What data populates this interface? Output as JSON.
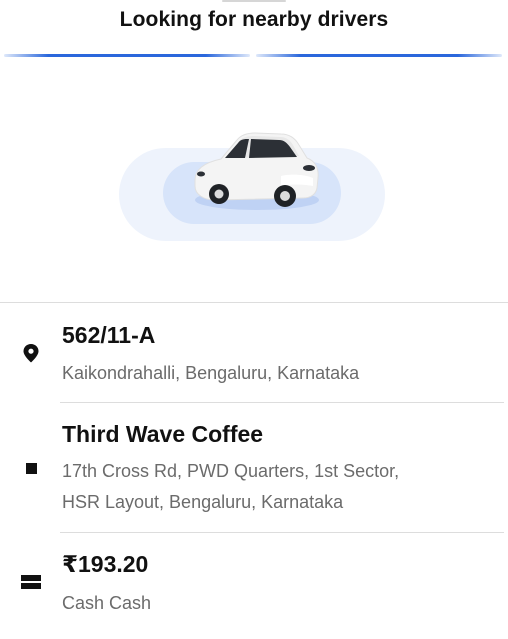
{
  "header": {
    "title": "Looking for nearby drivers"
  },
  "pickup": {
    "icon": "location-pin-icon",
    "name": "562/11-A",
    "address": "Kaikondrahalli, Bengaluru, Karnataka"
  },
  "dropoff": {
    "icon": "square-stop-icon",
    "name": "Third Wave Coffee",
    "address_line1": "17th Cross Rd, PWD Quarters, 1st Sector,",
    "address_line2": "HSR Layout, Bengaluru, Karnataka"
  },
  "payment": {
    "icon": "cash-icon",
    "amount": "₹193.20",
    "method": "Cash Cash"
  },
  "colors": {
    "accent": "#2a67dc",
    "halo_outer": "#eef3fc",
    "halo_inner": "#d7e4fa"
  }
}
